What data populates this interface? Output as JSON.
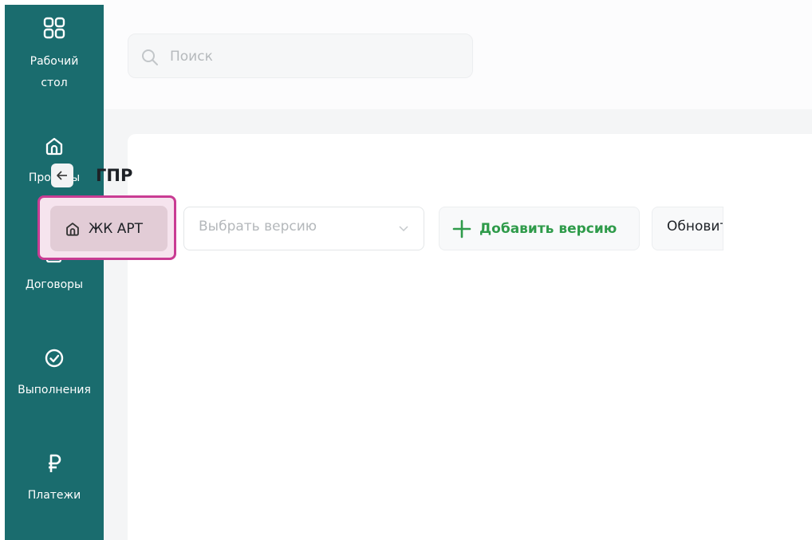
{
  "sidebar": {
    "items": [
      {
        "label": "Рабочий\nстол",
        "icon": "dashboard-icon"
      },
      {
        "label": "Проекты",
        "icon": "home-icon"
      },
      {
        "label": "Договоры",
        "icon": "document-icon"
      },
      {
        "label": "Выполнения",
        "icon": "check-circle-icon"
      },
      {
        "label": "Платежи",
        "icon": "ruble-icon"
      }
    ]
  },
  "search": {
    "placeholder": "Поиск"
  },
  "page": {
    "title": "ГПР"
  },
  "toolbar": {
    "project_label": "ЖК АРТ",
    "version_placeholder": "Выбрать версию",
    "add_version_label": "Добавить версию",
    "update_label": "Обновить"
  },
  "colors": {
    "sidebar": "#1a6c6e",
    "accent_green": "#2f9b4a",
    "highlight": "#c93c93"
  }
}
